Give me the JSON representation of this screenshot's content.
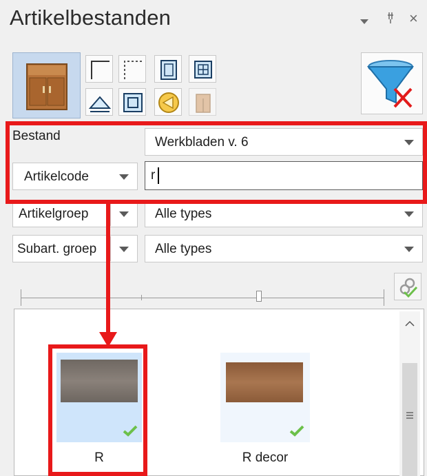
{
  "panel": {
    "title": "Artikelbestanden",
    "controls": {
      "dropdown": "▾",
      "pin": "ᵖ",
      "close": "×"
    }
  },
  "toolbar": {
    "big_icon": "cabinet-icon",
    "small_icons": [
      "corner-icon",
      "dotted-corner-icon",
      "door-icon",
      "grid-icon",
      "triangle-icon",
      "square-icon",
      "arrow-circle-icon",
      "cabinet-small-icon"
    ],
    "filter_icon": "filter-clear-icon"
  },
  "fields": {
    "bestand_label": "Bestand",
    "bestand_value": "Werkbladen v. 6",
    "code_type": "Artikelcode",
    "code_value": "r",
    "group_type": "Artikelgroep",
    "group_value": "Alle types",
    "subgroup_type": "Subart. groep",
    "subgroup_value": "Alle types"
  },
  "items": [
    {
      "label": "R",
      "selected": true,
      "color": "#7a6f66"
    },
    {
      "label": "R decor",
      "selected": false,
      "color": "#9a6a44"
    }
  ],
  "colors": {
    "highlight": "#e8191a",
    "selection": "#cfe5fb",
    "check": "#6cc04a"
  }
}
